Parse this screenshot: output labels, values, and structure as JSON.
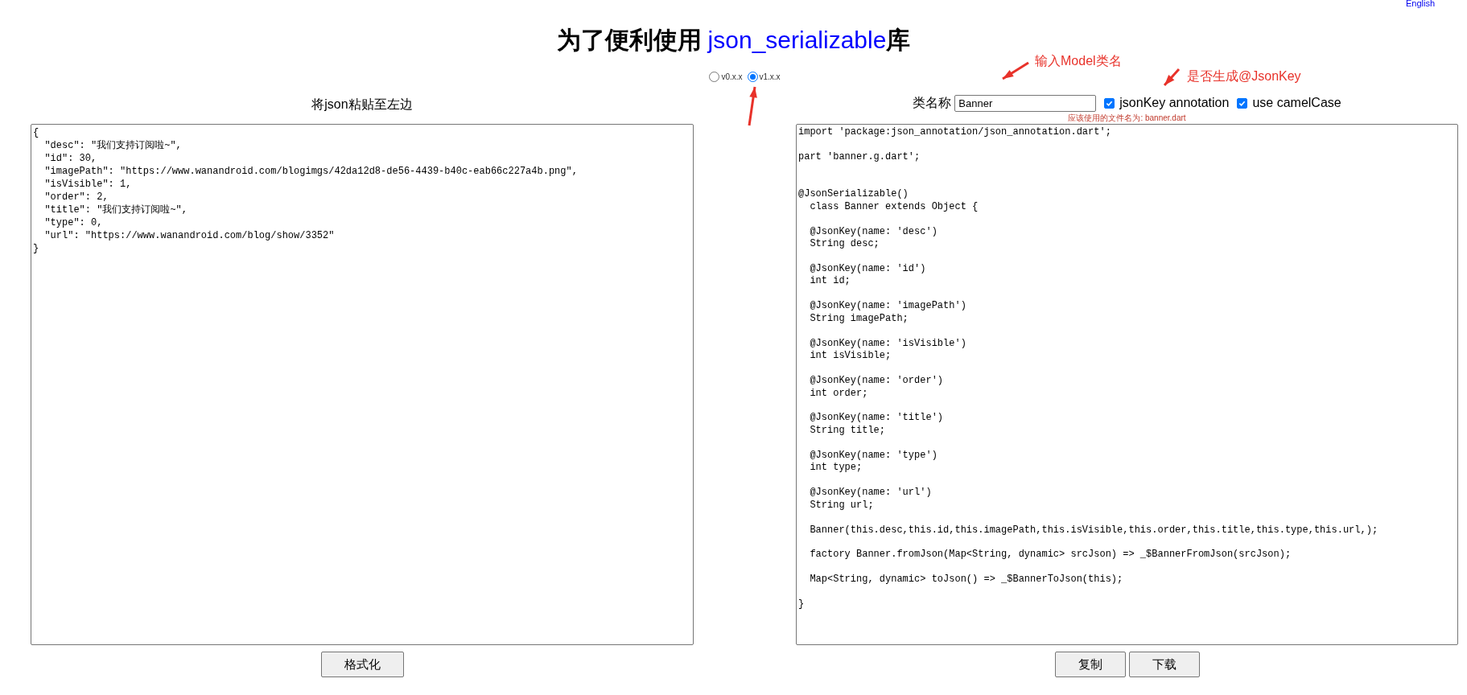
{
  "top_link": "English",
  "title": {
    "before": "为了便利使用",
    "link": "json_serializable",
    "after": "库"
  },
  "left": {
    "label": "将json粘贴至左边",
    "input": {
      "value": "{\n  \"desc\": \"我们支持订阅啦~\",\n  \"id\": 30,\n  \"imagePath\": \"https://www.wanandroid.com/blogimgs/42da12d8-de56-4439-b40c-eab66c227a4b.png\",\n  \"isVisible\": 1,\n  \"order\": 2,\n  \"title\": \"我们支持订阅啦~\",\n  \"type\": 0,\n  \"url\": \"https://www.wanandroid.com/blog/show/3352\"\n}"
    },
    "buttons": [
      "格式化"
    ]
  },
  "versions": [
    {
      "label": "v0.x.x",
      "selected": false
    },
    {
      "label": "v1.x.x",
      "selected": true
    }
  ],
  "right": {
    "class_name_label": "类名称",
    "class_name": "Banner",
    "options": [
      {
        "label": "jsonKey annotation",
        "checked": true
      },
      {
        "label": "use camelCase",
        "checked": true
      }
    ],
    "file_hint": "应该使用的文件名为: banner.dart",
    "output": {
      "value": "import 'package:json_annotation/json_annotation.dart';\n\npart 'banner.g.dart';\n\n\n@JsonSerializable()\n  class Banner extends Object {\n\n  @JsonKey(name: 'desc')\n  String desc;\n\n  @JsonKey(name: 'id')\n  int id;\n\n  @JsonKey(name: 'imagePath')\n  String imagePath;\n\n  @JsonKey(name: 'isVisible')\n  int isVisible;\n\n  @JsonKey(name: 'order')\n  int order;\n\n  @JsonKey(name: 'title')\n  String title;\n\n  @JsonKey(name: 'type')\n  int type;\n\n  @JsonKey(name: 'url')\n  String url;\n\n  Banner(this.desc,this.id,this.imagePath,this.isVisible,this.order,this.title,this.type,this.url,);\n\n  factory Banner.fromJson(Map<String, dynamic> srcJson) => _$BannerFromJson(srcJson);\n\n  Map<String, dynamic> toJson() => _$BannerToJson(this);\n\n}"
    },
    "buttons": [
      "复制",
      "下载"
    ]
  },
  "annotations": [
    "输入Model类名",
    "是否生成@JsonKey"
  ]
}
